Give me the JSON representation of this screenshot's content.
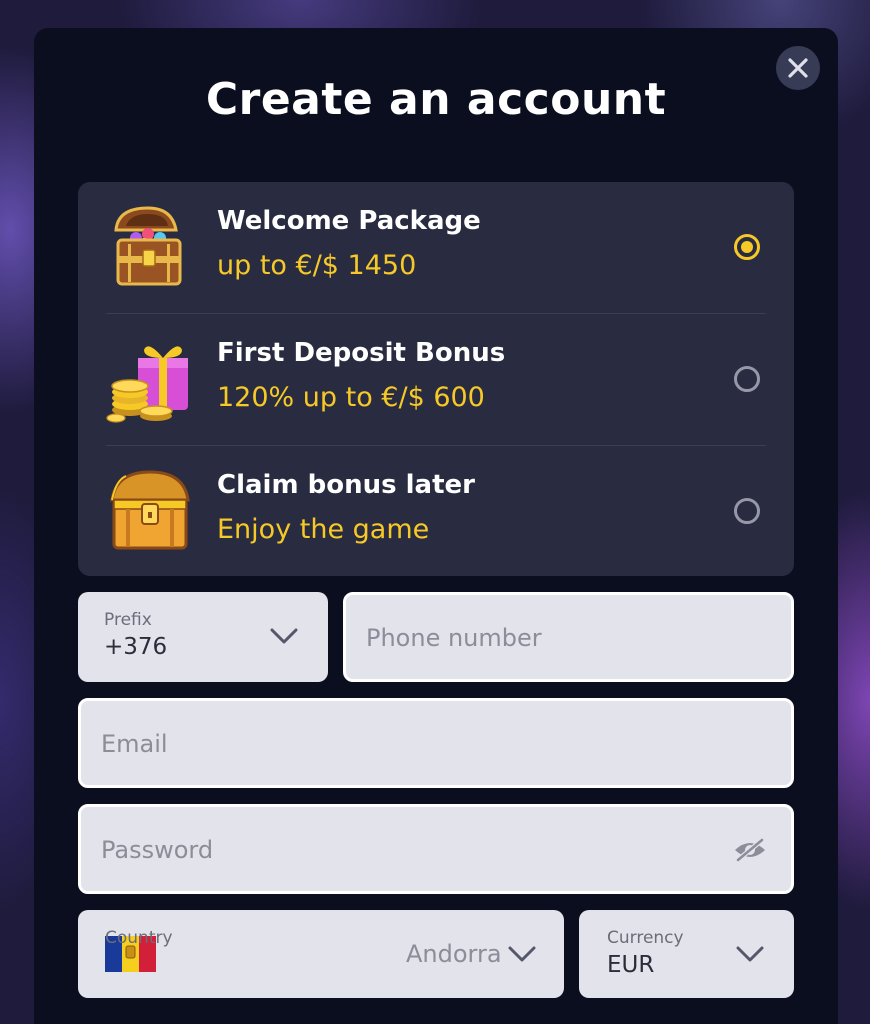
{
  "modal": {
    "title": "Create an account"
  },
  "bonuses": [
    {
      "title": "Welcome Package",
      "subtitle": "up to €/$ 1450",
      "icon": "treasure-chest-open-icon",
      "selected": true
    },
    {
      "title": "First Deposit Bonus",
      "subtitle": "120% up to €/$ 600",
      "icon": "gift-box-coins-icon",
      "selected": false
    },
    {
      "title": "Claim bonus later",
      "subtitle": "Enjoy the game",
      "icon": "treasure-chest-closed-icon",
      "selected": false
    }
  ],
  "form": {
    "prefix": {
      "label": "Prefix",
      "value": "+376"
    },
    "phone": {
      "placeholder": "Phone number"
    },
    "email": {
      "placeholder": "Email"
    },
    "password": {
      "placeholder": "Password"
    },
    "country": {
      "label": "Country",
      "value": "Andorra"
    },
    "currency": {
      "label": "Currency",
      "value": "EUR"
    }
  },
  "colors": {
    "accent": "#f6c927",
    "modal_bg": "#0b0e1f",
    "card_bg": "#292c41",
    "field_bg": "#e3e3ec"
  }
}
